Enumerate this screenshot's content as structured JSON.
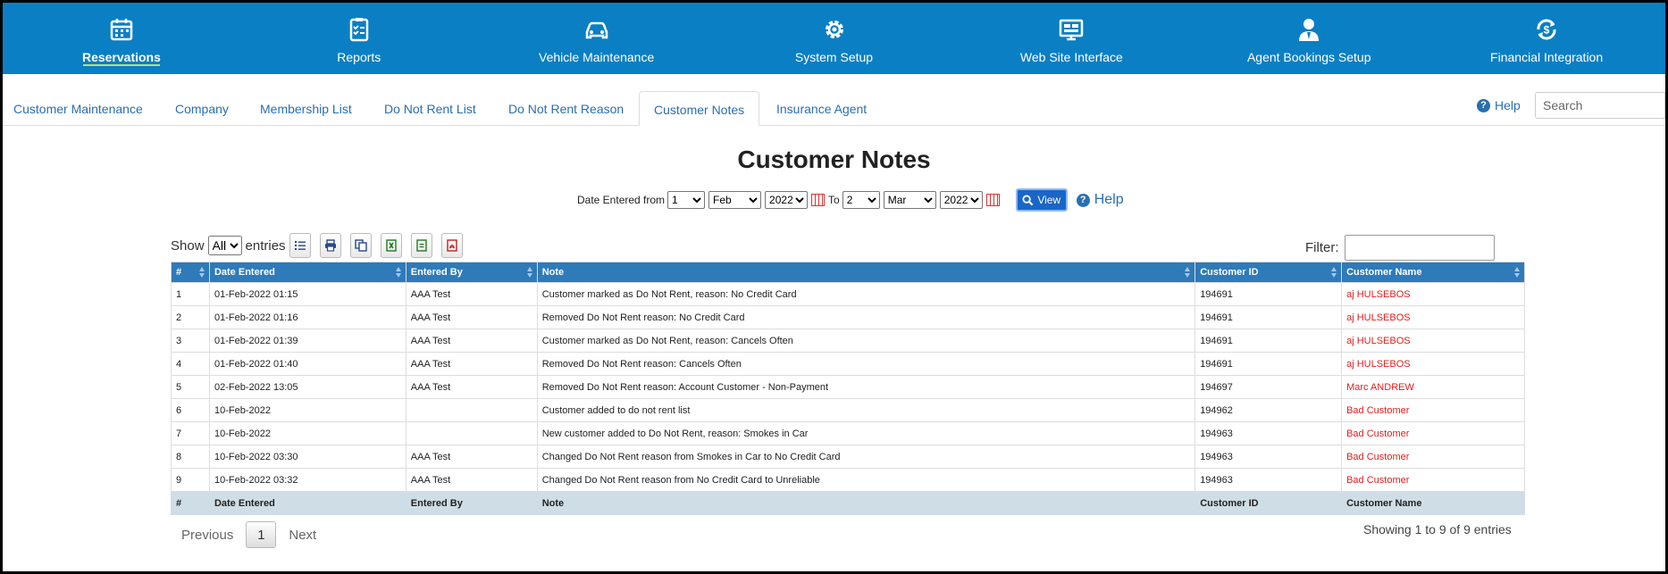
{
  "topnav": [
    {
      "label": "Reservations",
      "icon": "calendar-icon",
      "active": true
    },
    {
      "label": "Reports",
      "icon": "clipboard-icon"
    },
    {
      "label": "Vehicle Maintenance",
      "icon": "car-icon"
    },
    {
      "label": "System Setup",
      "icon": "gear-icon"
    },
    {
      "label": "Web Site Interface",
      "icon": "monitor-icon"
    },
    {
      "label": "Agent Bookings Setup",
      "icon": "agent-icon"
    },
    {
      "label": "Financial Integration",
      "icon": "dollar-cycle-icon"
    }
  ],
  "subtabs": [
    {
      "label": "Customer Maintenance"
    },
    {
      "label": "Company"
    },
    {
      "label": "Membership List"
    },
    {
      "label": "Do Not Rent List"
    },
    {
      "label": "Do Not Rent Reason"
    },
    {
      "label": "Customer Notes",
      "active": true
    },
    {
      "label": "Insurance Agent"
    }
  ],
  "help_label": "Help",
  "search_placeholder": "Search",
  "title": "Customer Notes",
  "date_filter": {
    "label": "Date Entered from",
    "from_day": "1",
    "from_month": "Feb",
    "from_year": "2022",
    "to_label": "To",
    "to_day": "2",
    "to_month": "Mar",
    "to_year": "2022",
    "view_label": "View",
    "help_label": "Help"
  },
  "table_controls": {
    "show_label": "Show",
    "entries_value": "All",
    "entries_label": "entries",
    "filter_label": "Filter:"
  },
  "columns": [
    "#",
    "Date Entered",
    "Entered By",
    "Note",
    "Customer ID",
    "Customer Name"
  ],
  "rows": [
    [
      "1",
      "01-Feb-2022 01:15",
      "AAA Test",
      "Customer marked as Do Not Rent, reason: No Credit Card",
      "194691",
      "aj HULSEBOS"
    ],
    [
      "2",
      "01-Feb-2022 01:16",
      "AAA Test",
      "Removed Do Not Rent reason: No Credit Card",
      "194691",
      "aj HULSEBOS"
    ],
    [
      "3",
      "01-Feb-2022 01:39",
      "AAA Test",
      "Customer marked as Do Not Rent, reason: Cancels Often",
      "194691",
      "aj HULSEBOS"
    ],
    [
      "4",
      "01-Feb-2022 01:40",
      "AAA Test",
      "Removed Do Not Rent reason: Cancels Often",
      "194691",
      "aj HULSEBOS"
    ],
    [
      "5",
      "02-Feb-2022 13:05",
      "AAA Test",
      "Removed Do Not Rent reason: Account Customer - Non-Payment",
      "194697",
      "Marc ANDREW"
    ],
    [
      "6",
      "10-Feb-2022",
      "",
      "Customer added to do not rent list",
      "194962",
      "Bad Customer"
    ],
    [
      "7",
      "10-Feb-2022",
      "",
      "New customer added to Do Not Rent, reason: Smokes in Car",
      "194963",
      "Bad Customer"
    ],
    [
      "8",
      "10-Feb-2022 03:30",
      "AAA Test",
      "Changed Do Not Rent reason from Smokes in Car to No Credit Card",
      "194963",
      "Bad Customer"
    ],
    [
      "9",
      "10-Feb-2022 03:32",
      "AAA Test",
      "Changed Do Not Rent reason from No Credit Card to Unreliable",
      "194963",
      "Bad Customer"
    ]
  ],
  "pager": {
    "previous": "Previous",
    "current": "1",
    "next": "Next"
  },
  "info": "Showing 1 to 9 of 9 entries",
  "colors": {
    "nav_bg": "#0a7fc4",
    "header_bg": "#2f7ab9",
    "footer_bg": "#cfdde7",
    "name_red": "#e02020",
    "link_blue": "#2a6fb0"
  }
}
